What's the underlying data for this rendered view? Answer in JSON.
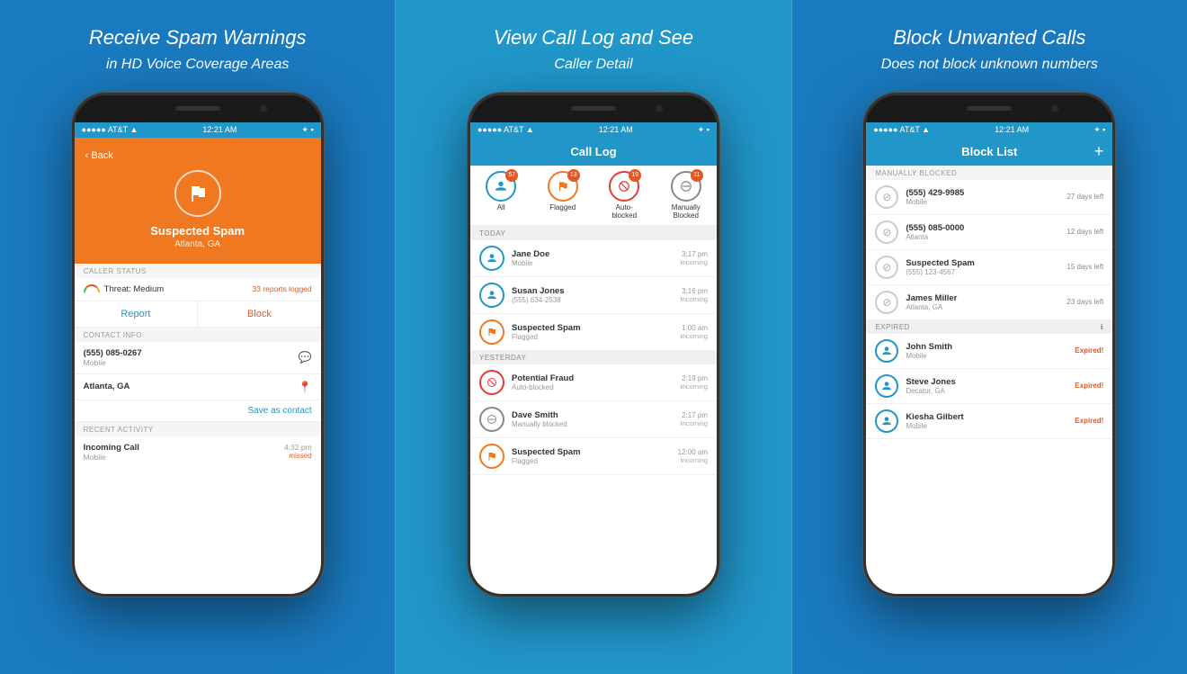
{
  "panels": [
    {
      "id": "spam-panel",
      "title": "Receive Spam Warnings",
      "subtitle": "in HD Voice Coverage Areas",
      "status_bar": {
        "carrier": "●●●●● AT&T ▲",
        "time": "12:21 AM",
        "icons": "✦ ■"
      },
      "back_label": "Back",
      "spam": {
        "label": "Suspected Spam",
        "location": "Atlanta, GA"
      },
      "caller_status_header": "CALLER STATUS",
      "threat_label": "Threat: Medium",
      "reports": "33 reports logged",
      "report_btn": "Report",
      "block_btn": "Block",
      "contact_info_header": "CONTACT INFO",
      "phone_number": "(555) 085-0267",
      "phone_type": "Mobile",
      "address": "Atlanta, GA",
      "save_contact": "Save as contact",
      "recent_activity_header": "RECENT ACTIVITY",
      "activity_name": "Incoming Call",
      "activity_sub": "Mobile",
      "activity_time": "4:32 pm",
      "activity_status": "missed"
    },
    {
      "id": "call-log-panel",
      "title": "View Call Log and See",
      "subtitle": "Caller Detail",
      "status_bar": {
        "carrier": "●●●●● AT&T ▲",
        "time": "12:21 AM",
        "icons": "✦ ■"
      },
      "nav_title": "Call Log",
      "filters": [
        {
          "label": "All",
          "badge": "57",
          "color": "#2196c9"
        },
        {
          "label": "Flagged",
          "badge": "13",
          "color": "#f07820"
        },
        {
          "label": "Auto-blocked",
          "badge": "19",
          "color": "#e53935"
        },
        {
          "label": "Manually\nBlocked",
          "badge": "11",
          "color": "#666"
        }
      ],
      "today_header": "TODAY",
      "today_calls": [
        {
          "name": "Jane Doe",
          "sub": "Mobile",
          "time": "3:17 pm",
          "dir": "Incoming",
          "type": "person"
        },
        {
          "name": "Susan Jones",
          "sub": "(555) 634-2538",
          "time": "3:16 pm",
          "dir": "Incoming",
          "type": "person"
        },
        {
          "name": "Suspected Spam",
          "sub": "Flagged",
          "time": "1:00 am",
          "dir": "Incoming",
          "type": "flag"
        }
      ],
      "yesterday_header": "YESTERDAY",
      "yesterday_calls": [
        {
          "name": "Potential Fraud",
          "sub": "Auto-blocked",
          "time": "2:19 pm",
          "dir": "Incoming",
          "type": "blocked"
        },
        {
          "name": "Dave Smith",
          "sub": "Manually blocked",
          "time": "2:17 pm",
          "dir": "Incoming",
          "type": "manual"
        },
        {
          "name": "Suspected Spam",
          "sub": "Flagged",
          "time": "12:00 am",
          "dir": "Incoming",
          "type": "flag"
        }
      ]
    },
    {
      "id": "block-list-panel",
      "title": "Block Unwanted Calls",
      "subtitle": "Does not block unknown numbers",
      "status_bar": {
        "carrier": "●●●●● AT&T ▲",
        "time": "12:21 AM",
        "icons": "✦ ■"
      },
      "nav_title": "Block List",
      "add_btn": "+",
      "manually_blocked_header": "MANUALLY BLOCKED",
      "manually_blocked": [
        {
          "name": "(555) 429-9985",
          "sub": "Mobile",
          "days": "27 days left"
        },
        {
          "name": "(555) 085-0000",
          "sub": "Atlanta",
          "days": "12 days left"
        },
        {
          "name": "Suspected Spam",
          "sub": "(555) 123-4567",
          "days": "15 days left"
        },
        {
          "name": "James Miller",
          "sub": "Atlanta, GA",
          "days": "23 days left"
        }
      ],
      "expired_header": "EXPIRED",
      "expired_items": [
        {
          "name": "John Smith",
          "sub": "Mobile",
          "status": "Expired!"
        },
        {
          "name": "Steve Jones",
          "sub": "Decatur, GA",
          "status": "Expired!"
        },
        {
          "name": "Kiesha Gilbert",
          "sub": "Mobile",
          "status": "Expired!"
        }
      ]
    }
  ]
}
